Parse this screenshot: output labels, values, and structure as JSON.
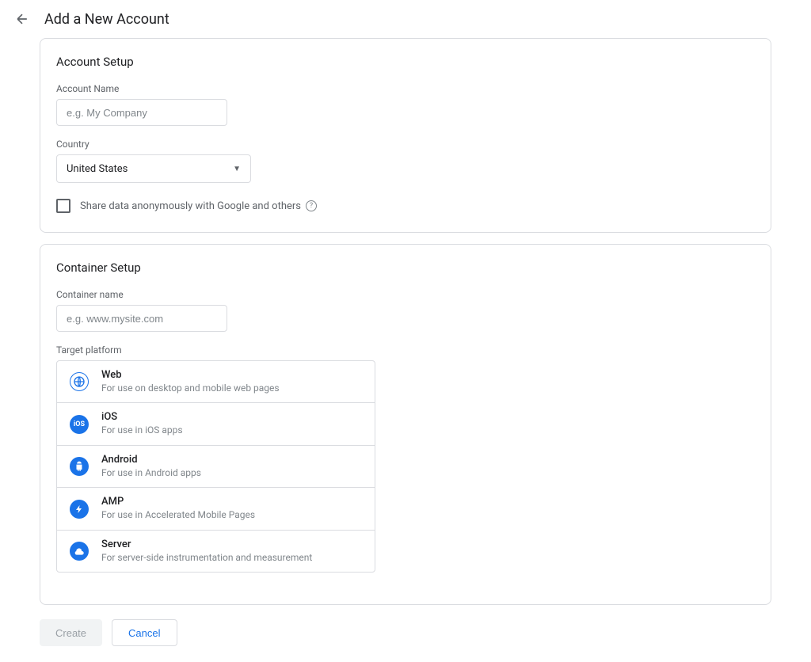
{
  "header": {
    "title": "Add a New Account"
  },
  "accountSetup": {
    "title": "Account Setup",
    "accountName": {
      "label": "Account Name",
      "placeholder": "e.g. My Company",
      "value": ""
    },
    "country": {
      "label": "Country",
      "value": "United States"
    },
    "shareData": {
      "label": "Share data anonymously with Google and others",
      "checked": false
    }
  },
  "containerSetup": {
    "title": "Container Setup",
    "containerName": {
      "label": "Container name",
      "placeholder": "e.g. www.mysite.com",
      "value": ""
    },
    "targetPlatform": {
      "label": "Target platform",
      "options": [
        {
          "icon": "globe-icon",
          "title": "Web",
          "desc": "For use on desktop and mobile web pages"
        },
        {
          "icon": "ios-icon",
          "title": "iOS",
          "desc": "For use in iOS apps"
        },
        {
          "icon": "android-icon",
          "title": "Android",
          "desc": "For use in Android apps"
        },
        {
          "icon": "amp-icon",
          "title": "AMP",
          "desc": "For use in Accelerated Mobile Pages"
        },
        {
          "icon": "server-icon",
          "title": "Server",
          "desc": "For server-side instrumentation and measurement"
        }
      ]
    }
  },
  "footer": {
    "createLabel": "Create",
    "cancelLabel": "Cancel"
  }
}
